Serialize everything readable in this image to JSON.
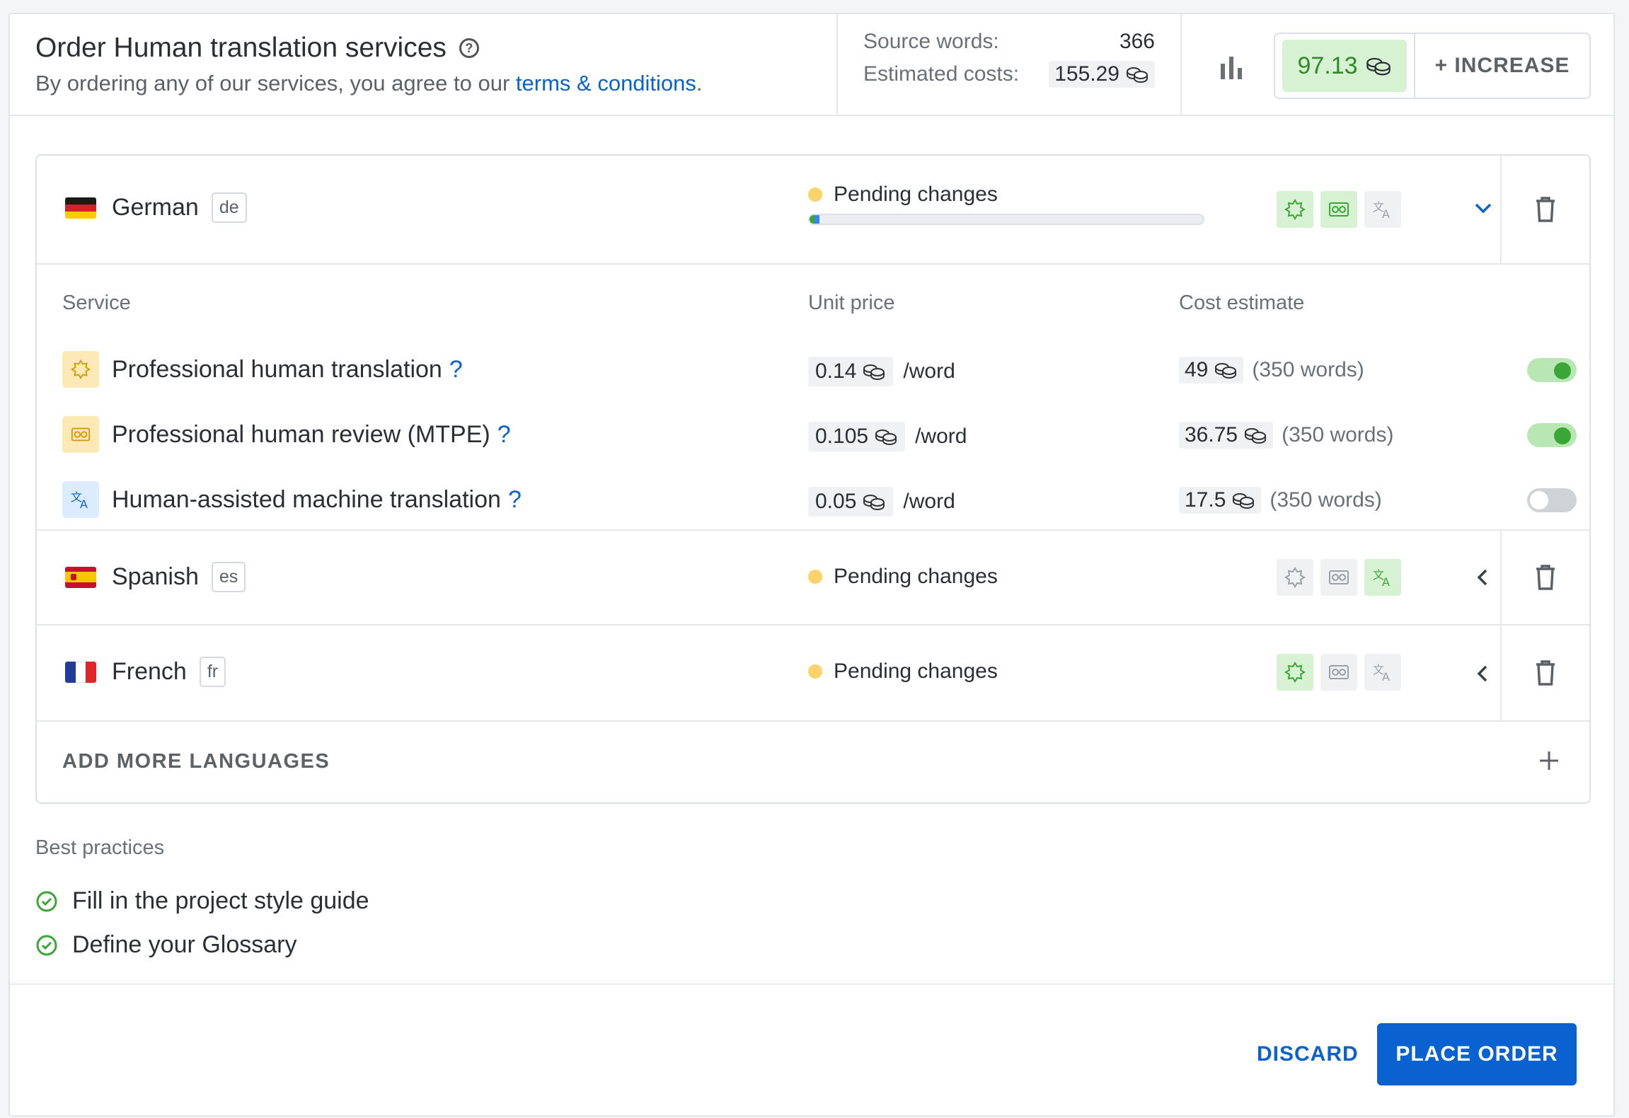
{
  "header": {
    "title": "Order Human translation services",
    "subtitle_prefix": "By ordering any of our services, you agree to our ",
    "terms_link": "terms & conditions",
    "subtitle_suffix": ".",
    "source_words_label": "Source words:",
    "source_words_value": "366",
    "estimated_costs_label": "Estimated costs:",
    "estimated_costs_value": "155.29",
    "balance": "97.13",
    "increase_label": "+ INCREASE"
  },
  "languages": [
    {
      "name": "German",
      "code": "de",
      "status": "Pending changes",
      "progress_fraction": 0.025,
      "expanded": true,
      "services_enabled": [
        true,
        true,
        false
      ]
    },
    {
      "name": "Spanish",
      "code": "es",
      "status": "Pending changes",
      "expanded": false,
      "services_enabled": [
        false,
        false,
        true
      ]
    },
    {
      "name": "French",
      "code": "fr",
      "status": "Pending changes",
      "expanded": false,
      "services_enabled": [
        true,
        false,
        false
      ]
    }
  ],
  "services_table": {
    "col_service": "Service",
    "col_unit_price": "Unit price",
    "col_cost_estimate": "Cost estimate",
    "rows": [
      {
        "label": "Professional human translation",
        "help": "?",
        "price": "0.14",
        "unit": "/word",
        "cost": "49",
        "words": "(350 words)",
        "enabled": true
      },
      {
        "label": "Professional human review (MTPE)",
        "help": "?",
        "price": "0.105",
        "unit": "/word",
        "cost": "36.75",
        "words": "(350 words)",
        "enabled": true
      },
      {
        "label": "Human-assisted machine translation",
        "help": "?",
        "price": "0.05",
        "unit": "/word",
        "cost": "17.5",
        "words": "(350 words)",
        "enabled": false
      }
    ]
  },
  "add_more_languages": "ADD MORE LANGUAGES",
  "best_practices": {
    "title": "Best practices",
    "items": [
      "Fill in the project style guide",
      "Define your Glossary"
    ]
  },
  "footer": {
    "discard": "DISCARD",
    "place_order": "PLACE ORDER"
  },
  "colors": {
    "accent": "#0a62d0",
    "success": "#3aa635",
    "success_bg": "#d7f2d3",
    "pending": "#fad36b"
  },
  "icons": {
    "translation": "sparkle-badge-icon",
    "review": "glasses-icon",
    "machine": "translate-icon",
    "coins": "coins-icon",
    "stats": "bar-chart-icon",
    "delete": "trash-icon",
    "add": "plus-icon",
    "check": "check-circle-icon"
  }
}
